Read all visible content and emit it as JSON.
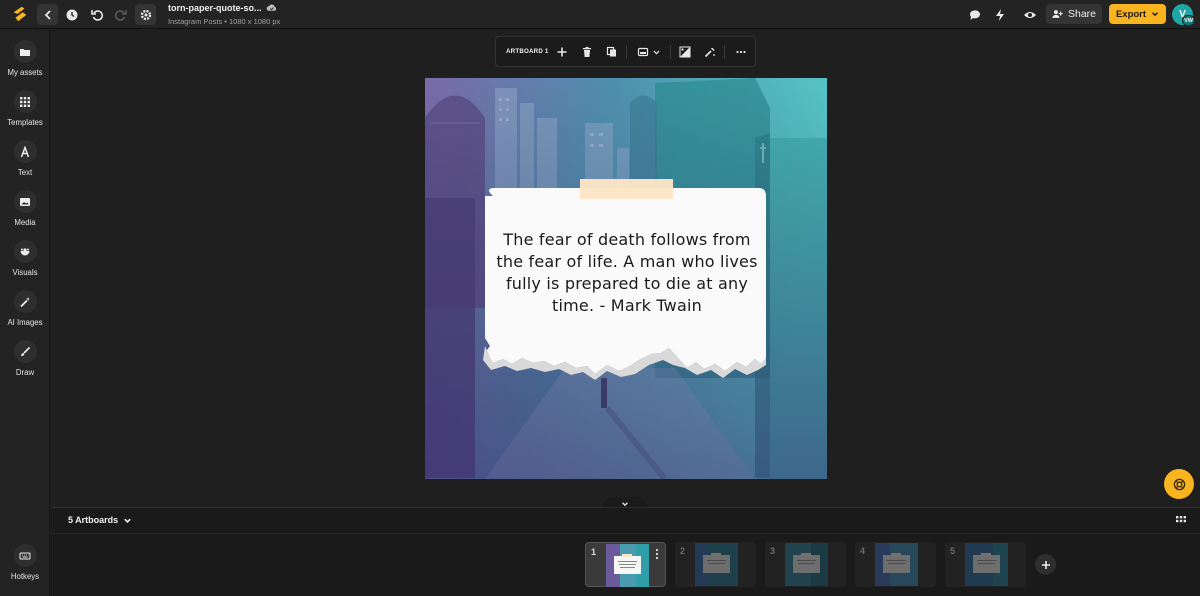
{
  "header": {
    "file_name": "torn-paper-quote-so...",
    "file_subtitle": "Instagram Posts • 1080 x 1080 px",
    "share_label": "Share",
    "export_label": "Export",
    "avatar_initial": "V",
    "avatar_badge": "VW",
    "icons": [
      "logo-icon",
      "back-icon",
      "history-icon",
      "undo-icon",
      "redo-icon",
      "settings-icon",
      "cloud-icon",
      "comment-icon",
      "lightning-icon",
      "preview-icon",
      "add-user-icon",
      "chevron-down-icon"
    ]
  },
  "sidebar": {
    "items": [
      {
        "label": "My assets",
        "icon": "folder-icon"
      },
      {
        "label": "Templates",
        "icon": "grid-icon"
      },
      {
        "label": "Text",
        "icon": "text-icon"
      },
      {
        "label": "Media",
        "icon": "image-icon"
      },
      {
        "label": "Visuals",
        "icon": "visuals-icon"
      },
      {
        "label": "AI Images",
        "icon": "magic-wand-icon"
      },
      {
        "label": "Draw",
        "icon": "brush-icon"
      }
    ],
    "hotkeys_label": "Hotkeys"
  },
  "toolbar": {
    "artboard_label": "ARTBOARD 1",
    "icons": [
      "add-icon",
      "delete-icon",
      "duplicate-icon",
      "background-icon",
      "chevron-down-icon",
      "transparency-icon",
      "magic-icon",
      "more-icon"
    ]
  },
  "canvas": {
    "quote_text": "The fear of death follows from the fear of life. A man who lives fully is prepared to die at any time. - Mark Twain",
    "gradient_colors": [
      "#6a5a9c",
      "#3b9fa8",
      "#55c8c8"
    ],
    "tape_color": "#fde5c6"
  },
  "bottom_panel": {
    "artboards_label": "5 Artboards",
    "thumbnails": [
      {
        "number": "1",
        "active": true
      },
      {
        "number": "2",
        "active": false
      },
      {
        "number": "3",
        "active": false
      },
      {
        "number": "4",
        "active": false
      },
      {
        "number": "5",
        "active": false
      }
    ]
  },
  "colors": {
    "accent": "#f9b41f",
    "avatar": "#1fa6a6",
    "background": "#1f1f1f"
  }
}
